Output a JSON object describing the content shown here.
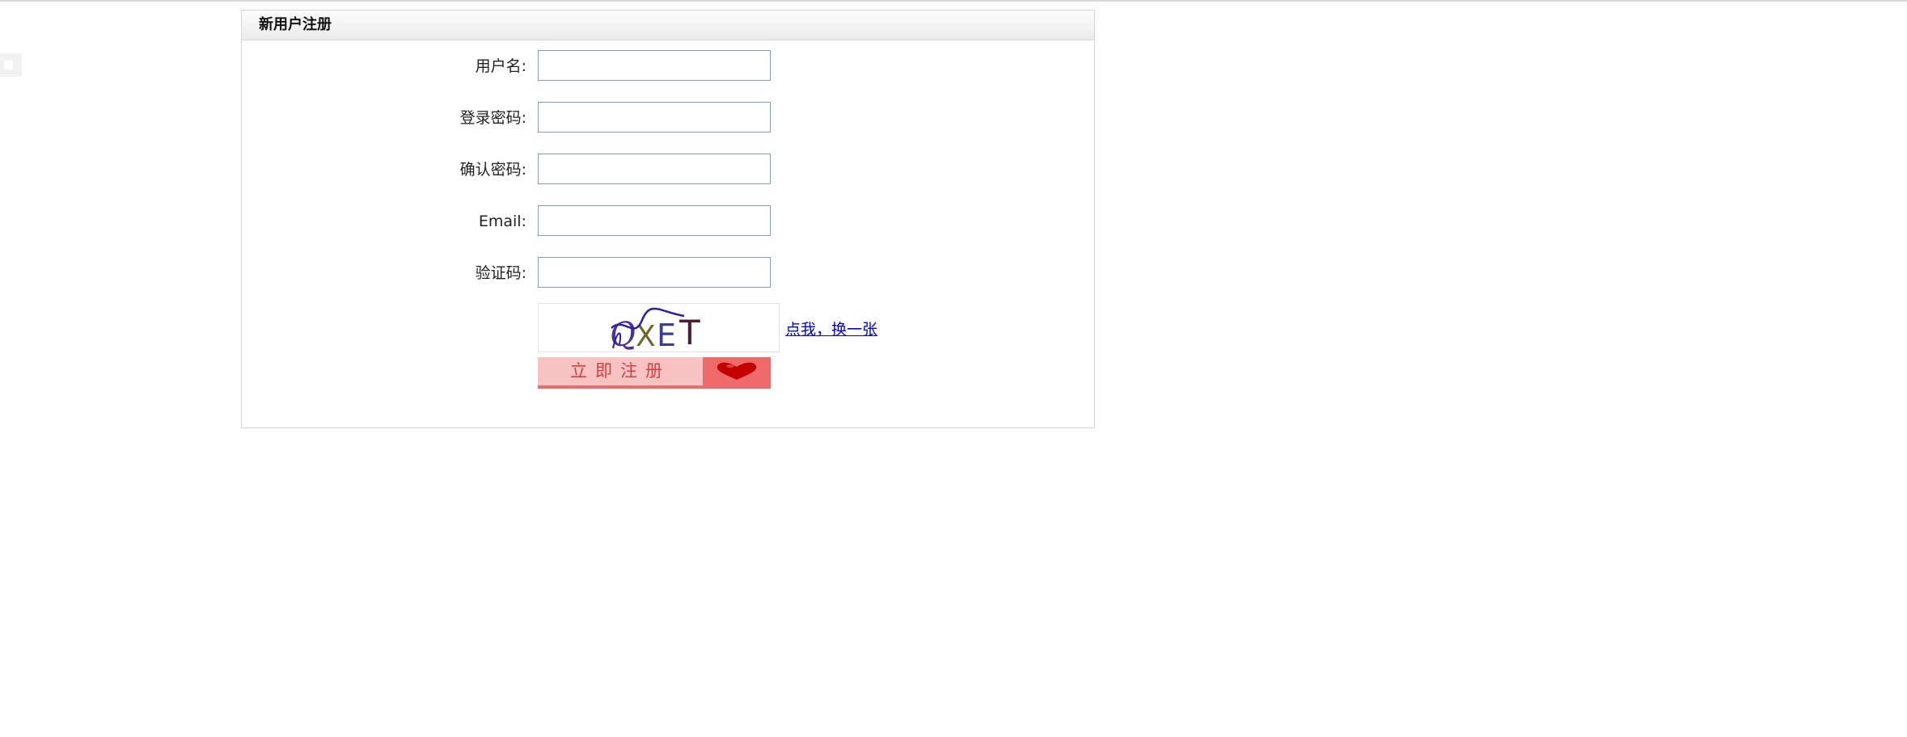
{
  "panel": {
    "title": "新用户注册"
  },
  "form": {
    "fields": [
      {
        "label": "用户名:",
        "value": ""
      },
      {
        "label": "登录密码:",
        "value": ""
      },
      {
        "label": "确认密码:",
        "value": ""
      },
      {
        "label": "Email:",
        "value": ""
      },
      {
        "label": "验证码:",
        "value": ""
      }
    ],
    "captcha": {
      "text": "QXET",
      "refresh_link": "点我，换一张"
    },
    "submit_label": "立即注册"
  },
  "icons": {
    "submit_decoration": "heart-icon"
  },
  "colors": {
    "input_border": "#7f9db9",
    "link": "#0000ee",
    "button_bg": "#f9c3c3",
    "button_accent": "#ef6b6b",
    "heart": "#c40000"
  }
}
